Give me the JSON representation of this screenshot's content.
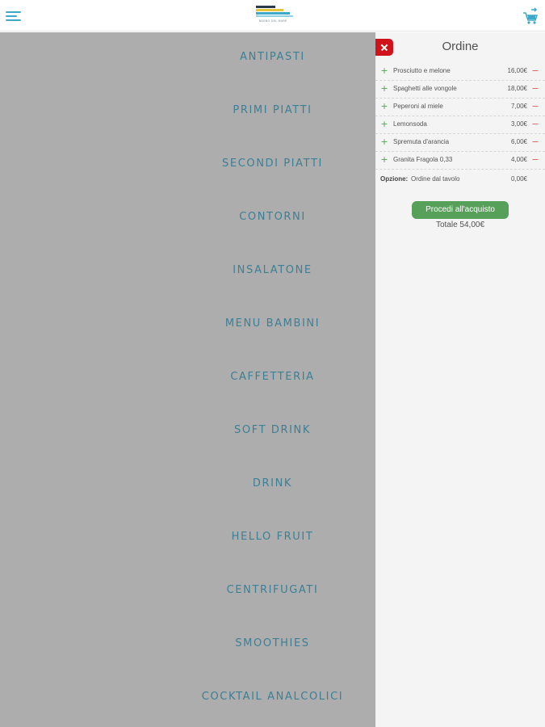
{
  "header": {
    "logo_text": "BAGNO DEL MARE",
    "menu_icon": "hamburger-menu-icon",
    "cart_icon": "cart-icon",
    "accent_color": "#3ea8c8"
  },
  "categories": [
    "ANTIPASTI",
    "PRIMI PIATTI",
    "SECONDI PIATTI",
    "CONTORNI",
    "INSALATONE",
    "MENU BAMBINI",
    "CAFFETTERIA",
    "SOFT DRINK",
    "DRINK",
    "HELLO FRUIT",
    "CENTRIFUGATI",
    "SMOOTHIES",
    "COCKTAIL ANALCOLICI"
  ],
  "order": {
    "title": "Ordine",
    "items": [
      {
        "name": "Prosciutto e melone",
        "price": "16,00€"
      },
      {
        "name": "Spaghetti alle vongole",
        "price": "18,00€"
      },
      {
        "name": "Peperoni al miele",
        "price": "7,00€"
      },
      {
        "name": "Lemonsoda",
        "price": "3,00€"
      },
      {
        "name": "Spremuta d'arancia",
        "price": "6,00€"
      },
      {
        "name": "Granita Fragola 0,33",
        "price": "4,00€"
      }
    ],
    "option_label": "Opzione:",
    "option_value": "Ordine dal tavolo",
    "option_price": "0,00€",
    "checkout_label": "Procedi all'acquisto",
    "total": "Totale 54,00€",
    "colors": {
      "close": "#d0121b",
      "checkout": "#57a05a",
      "plus": "#4fa64f",
      "minus": "#e05a5a"
    }
  }
}
